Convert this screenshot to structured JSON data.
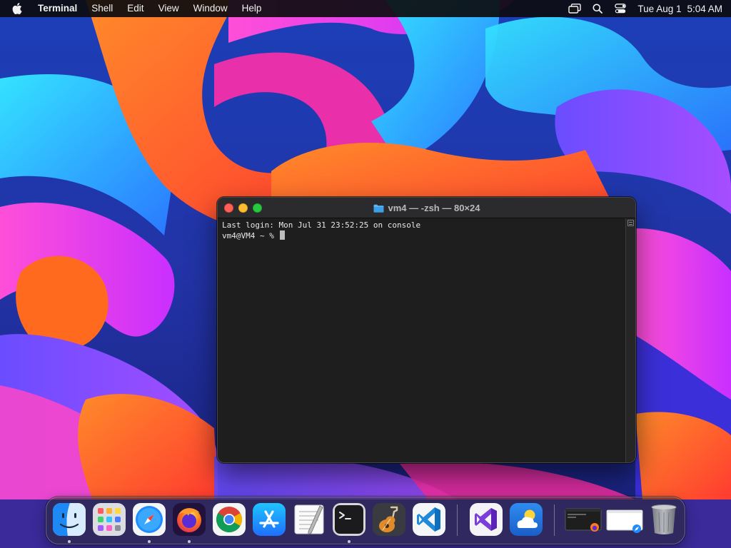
{
  "menubar": {
    "app_name": "Terminal",
    "menus": [
      "Shell",
      "Edit",
      "View",
      "Window",
      "Help"
    ],
    "status_icons": [
      "screen-mirroring-icon",
      "spotlight-search-icon",
      "control-center-icon"
    ],
    "date": "Tue Aug 1",
    "time": "5:04 AM"
  },
  "terminal": {
    "title": "vm4 — -zsh — 80×24",
    "title_icon": "folder-icon",
    "lines": [
      "Last login: Mon Jul 31 23:52:25 on console",
      "vm4@VM4 ~ % "
    ]
  },
  "dock": {
    "apps": [
      {
        "name": "Finder",
        "icon": "finder-icon",
        "running": true
      },
      {
        "name": "Launchpad",
        "icon": "launchpad-icon",
        "running": false
      },
      {
        "name": "Safari",
        "icon": "safari-icon",
        "running": true
      },
      {
        "name": "Firefox",
        "icon": "firefox-icon",
        "running": true
      },
      {
        "name": "Google Chrome",
        "icon": "chrome-icon",
        "running": false
      },
      {
        "name": "App Store",
        "icon": "app-store-icon",
        "running": false
      },
      {
        "name": "TextEdit",
        "icon": "textedit-icon",
        "running": false
      },
      {
        "name": "Terminal",
        "icon": "terminal-icon",
        "running": true
      },
      {
        "name": "GarageBand",
        "icon": "garageband-icon",
        "running": false
      },
      {
        "name": "Visual Studio Code",
        "icon": "vscode-icon",
        "running": false
      },
      {
        "name": "Visual Studio",
        "icon": "visual-studio-icon",
        "running": false
      },
      {
        "name": "Weather",
        "icon": "weather-icon",
        "running": false
      }
    ],
    "recent": [
      {
        "name": "Terminal window with Firefox",
        "icon": "minimized-terminal-window-icon"
      },
      {
        "name": "Safari window",
        "icon": "minimized-safari-window-icon"
      }
    ],
    "trash": {
      "name": "Trash",
      "icon": "trash-icon"
    }
  }
}
